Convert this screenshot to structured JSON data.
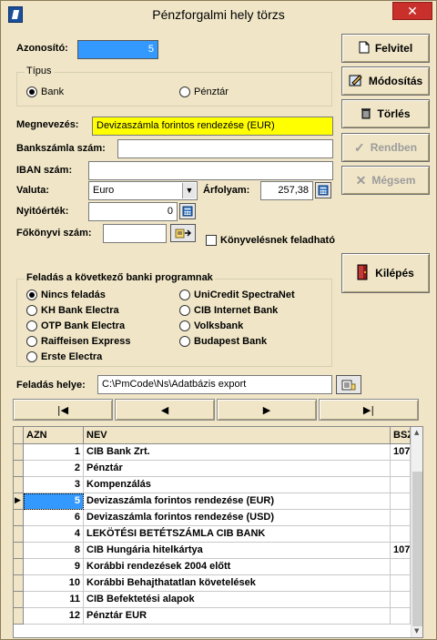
{
  "window": {
    "title": "Pénzforgalmi hely törzs",
    "close_label": "✕"
  },
  "form": {
    "azonosito_label": "Azonosító:",
    "azonosito_value": "5",
    "tipus_label": "Típus",
    "tipus_options": [
      {
        "label": "Bank",
        "checked": true
      },
      {
        "label": "Pénztár",
        "checked": false
      }
    ],
    "megnevezes_label": "Megnevezés:",
    "megnevezes_value": "Devizaszámla forintos rendezése (EUR)",
    "bankszamla_label": "Bankszámla szám:",
    "bankszamla_value": "",
    "iban_label": "IBAN szám:",
    "iban_value": "",
    "valuta_label": "Valuta:",
    "valuta_value": "Euro",
    "arfolyam_label": "Árfolyam:",
    "arfolyam_value": "257,38",
    "nyitoertek_label": "Nyitóérték:",
    "nyitoertek_value": "0",
    "fokonyvi_label": "Főkönyvi szám:",
    "fokonyvi_value": "",
    "konyvelesnek_label": "Könyvelésnek feladható",
    "banki_group_label": "Feladás a következő banki programnak",
    "banki_options": [
      {
        "label": "Nincs feladás",
        "checked": true
      },
      {
        "label": "KH Bank Electra",
        "checked": false
      },
      {
        "label": "OTP Bank Electra",
        "checked": false
      },
      {
        "label": "Raiffeisen Express",
        "checked": false
      },
      {
        "label": "Erste Electra",
        "checked": false
      },
      {
        "label": "UniCredit SpectraNet",
        "checked": false
      },
      {
        "label": "CIB Internet Bank",
        "checked": false
      },
      {
        "label": "Volksbank",
        "checked": false
      },
      {
        "label": "Budapest Bank",
        "checked": false
      }
    ],
    "feladas_helye_label": "Feladás helye:",
    "feladas_helye_value": "C:\\PmCode\\Ns\\Adatbázis export"
  },
  "buttons": {
    "felvitel": "Felvitel",
    "modositas": "Módosítás",
    "torles": "Törlés",
    "rendben": "Rendben",
    "megsem": "Mégsem",
    "kilepes": "Kilépés"
  },
  "nav": {
    "first": "|◀",
    "prev": "◀",
    "next": "▶",
    "last": "▶|"
  },
  "grid": {
    "columns": [
      "AZN",
      "NEV",
      "BSZ"
    ],
    "rows": [
      {
        "azn": "1",
        "nev": "CIB Bank Zrt.",
        "bsz": "107"
      },
      {
        "azn": "2",
        "nev": "Pénztár",
        "bsz": ""
      },
      {
        "azn": "3",
        "nev": "Kompenzálás",
        "bsz": ""
      },
      {
        "azn": "5",
        "nev": "Devizaszámla forintos rendezése (EUR)",
        "bsz": "",
        "selected": true
      },
      {
        "azn": "6",
        "nev": "Devizaszámla forintos rendezése (USD)",
        "bsz": ""
      },
      {
        "azn": "4",
        "nev": "LEKÖTÉSI BETÉTSZÁMLA CIB BANK",
        "bsz": ""
      },
      {
        "azn": "8",
        "nev": "CIB Hungária hitelkártya",
        "bsz": "107"
      },
      {
        "azn": "9",
        "nev": "Korábbi rendezések 2004 előtt",
        "bsz": ""
      },
      {
        "azn": "10",
        "nev": "Korábbi Behajthatatlan követelések",
        "bsz": ""
      },
      {
        "azn": "11",
        "nev": "CIB Befektetési alapok",
        "bsz": ""
      },
      {
        "azn": "12",
        "nev": "Pénztár EUR",
        "bsz": ""
      }
    ]
  },
  "colors": {
    "accent": "#3399ff",
    "highlight": "#ffff00",
    "window": "#f0e6c7"
  }
}
